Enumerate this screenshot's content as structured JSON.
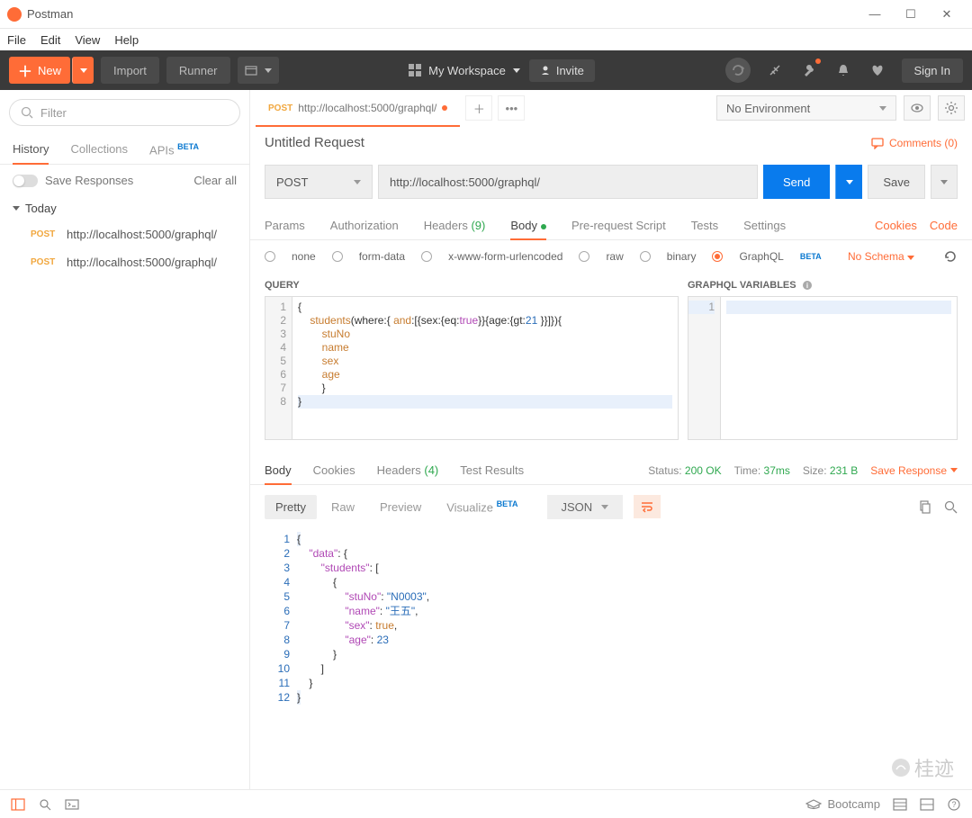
{
  "window": {
    "title": "Postman"
  },
  "menu": [
    "File",
    "Edit",
    "View",
    "Help"
  ],
  "toolbar": {
    "new": "New",
    "import": "Import",
    "runner": "Runner",
    "workspace": "My Workspace",
    "invite": "Invite",
    "signin": "Sign In"
  },
  "sidebar": {
    "filter_placeholder": "Filter",
    "tabs": {
      "history": "History",
      "collections": "Collections",
      "apis": "APIs",
      "beta": "BETA"
    },
    "save_responses": "Save Responses",
    "clear_all": "Clear all",
    "today": "Today",
    "items": [
      {
        "method": "POST",
        "url": "http://localhost:5000/graphql/"
      },
      {
        "method": "POST",
        "url": "http://localhost:5000/graphql/"
      }
    ]
  },
  "tab": {
    "method": "POST",
    "url_short": "http://localhost:5000/graphql/",
    "no_env": "No Environment"
  },
  "request": {
    "title": "Untitled Request",
    "comments": "Comments (0)",
    "method": "POST",
    "url": "http://localhost:5000/graphql/",
    "send": "Send",
    "save": "Save",
    "tabs": {
      "params": "Params",
      "auth": "Authorization",
      "headers": "Headers",
      "headers_count": "(9)",
      "body": "Body",
      "prereq": "Pre-request Script",
      "tests": "Tests",
      "settings": "Settings",
      "cookies": "Cookies",
      "code": "Code"
    },
    "body_types": {
      "none": "none",
      "form": "form-data",
      "xwww": "x-www-form-urlencoded",
      "raw": "raw",
      "binary": "binary",
      "graphql": "GraphQL",
      "beta": "BETA",
      "schema": "No Schema"
    },
    "query_label": "QUERY",
    "vars_label": "GRAPHQL VARIABLES",
    "query_lines": [
      "1",
      "2",
      "3",
      "4",
      "5",
      "6",
      "7",
      "8"
    ]
  },
  "query_code": {
    "l1": "{",
    "l2a": "    students",
    "l2b": "(where:{ ",
    "l2c": "and",
    "l2d": ":[{sex:{eq:",
    "l2e": "true",
    "l2f": "}}{age:{gt:",
    "l2g": "21",
    "l2h": " }}]}){",
    "l3": "        stuNo",
    "l4": "        name",
    "l5": "        sex",
    "l6": "        age",
    "l7": "        }",
    "l8": "}"
  },
  "response": {
    "tabs": {
      "body": "Body",
      "cookies": "Cookies",
      "headers": "Headers",
      "headers_count": "(4)",
      "tests": "Test Results"
    },
    "status_lbl": "Status:",
    "status": "200 OK",
    "time_lbl": "Time:",
    "time": "37ms",
    "size_lbl": "Size:",
    "size": "231 B",
    "save_response": "Save Response",
    "views": {
      "pretty": "Pretty",
      "raw": "Raw",
      "preview": "Preview",
      "visualize": "Visualize",
      "beta": "BETA",
      "json": "JSON"
    },
    "lines": [
      "1",
      "2",
      "3",
      "4",
      "5",
      "6",
      "7",
      "8",
      "9",
      "10",
      "11",
      "12"
    ]
  },
  "json": {
    "data": "\"data\"",
    "students": "\"students\"",
    "stuNo_k": "\"stuNo\"",
    "stuNo_v": "\"N0003\"",
    "name_k": "\"name\"",
    "name_v": "\"王五\"",
    "sex_k": "\"sex\"",
    "sex_v": "true",
    "age_k": "\"age\"",
    "age_v": "23"
  },
  "statusbar": {
    "bootcamp": "Bootcamp"
  },
  "watermark": "桂迹"
}
